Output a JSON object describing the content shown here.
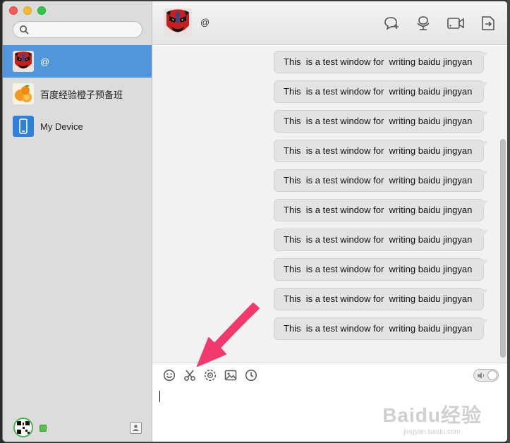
{
  "sidebar": {
    "search_placeholder": "",
    "contacts": [
      {
        "name": "@",
        "avatar": "peking-opera-mask",
        "active": true
      },
      {
        "name": "百度经验橙子预备班",
        "avatar": "oranges"
      },
      {
        "name": "My Device",
        "avatar": "phone"
      }
    ]
  },
  "chat": {
    "title": "@",
    "header_icons": [
      "new-chat-icon",
      "microphone-icon",
      "video-call-icon",
      "file-transfer-icon"
    ],
    "messages": [
      "This  is a test window for  writing baidu jingyan",
      "This  is a test window for  writing baidu jingyan",
      "This  is a test window for  writing baidu jingyan",
      "This  is a test window for  writing baidu jingyan",
      "This  is a test window for  writing baidu jingyan",
      "This  is a test window for  writing baidu jingyan",
      "This  is a test window for  writing baidu jingyan",
      "This  is a test window for  writing baidu jingyan",
      "This  is a test window for  writing baidu jingyan",
      "This  is a test window for  writing baidu jingyan"
    ],
    "toolbar_icons": [
      "emoji-icon",
      "screenshot-scissors-icon",
      "shake-icon",
      "image-icon",
      "history-clock-icon"
    ],
    "input_value": ""
  },
  "watermark": {
    "line1": "Bai",
    "paw": "du",
    "brand": "经验",
    "line2": "jingyan.baidu.com"
  },
  "colors": {
    "accent": "#4f96db",
    "arrow": "#f03a6e",
    "online": "#55c24a"
  }
}
